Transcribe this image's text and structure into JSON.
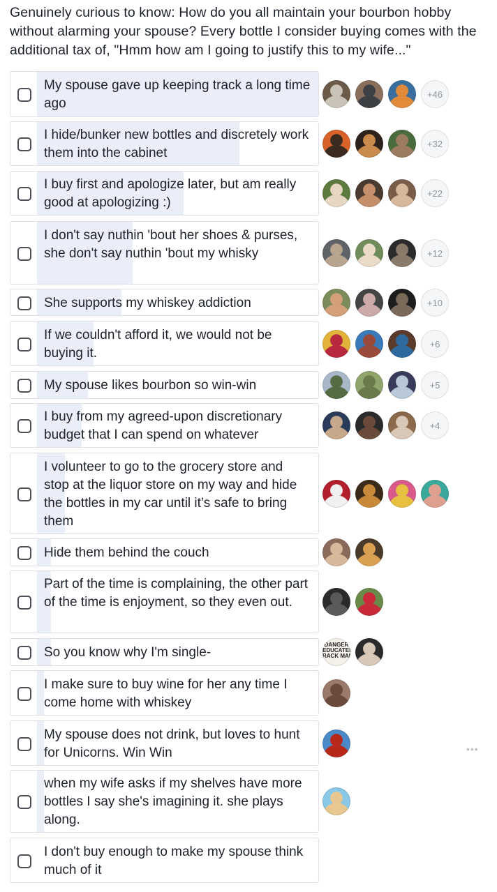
{
  "question": "Genuinely curious to know: How do you all maintain your bourbon hobby without alarming your spouse? Every bottle I consider buying comes with the additional tax of, \"Hmm how am I going to justify this to my wife...\"",
  "options": [
    {
      "label": "My spouse gave up keeping track a long time ago",
      "share": 1.0,
      "more": "+46"
    },
    {
      "label": "I hide/bunker new bottles and discretely work them into the cabinet",
      "share": 0.72,
      "more": "+32"
    },
    {
      "label": "I buy first and apologize later, but am really good at apologizing :)",
      "share": 0.52,
      "more": "+22"
    },
    {
      "label": "I don't say nuthin 'bout her shoes & purses, she don't say nuthin 'bout my whisky",
      "share": 0.34,
      "more": "+12"
    },
    {
      "label": "She supports my whiskey addiction",
      "share": 0.3,
      "more": "+10"
    },
    {
      "label": "If we couldn't afford it, we would not be buying it.",
      "share": 0.2,
      "more": "+6"
    },
    {
      "label": "My spouse likes bourbon so win-win",
      "share": 0.18,
      "more": "+5"
    },
    {
      "label": "I buy from my agreed-upon discretionary budget that I can spend on whatever",
      "share": 0.16,
      "more": "+4"
    },
    {
      "label": "I volunteer to go to the grocery store and stop at the liquor store on my way and hide the bottles in my car until it’s safe to bring them",
      "share": 0.1,
      "more": ""
    },
    {
      "label": "Hide them behind the couch",
      "share": 0.05,
      "more": ""
    },
    {
      "label": "Part of the time is complaining, the other part of the time is enjoyment, so they even out.",
      "share": 0.05,
      "more": ""
    },
    {
      "label": "So you know why I'm single-",
      "share": 0.05,
      "more": ""
    },
    {
      "label": "I make sure to buy wine for her any time I come home with whiskey",
      "share": 0.025,
      "more": ""
    },
    {
      "label": "My spouse does not drink, but loves to hunt for Unicorns. Win Win",
      "share": 0.025,
      "more": ""
    },
    {
      "label": "when my wife asks if my shelves have more bottles I say she's imagining it. she plays along.",
      "share": 0.025,
      "more": ""
    },
    {
      "label": "I don't buy enough to make my spouse think much of it",
      "share": 0.0,
      "more": ""
    }
  ],
  "sign_text": "DANGER\nEDUCATED\nRACK MAN",
  "more_options_icon": "ellipsis-icon",
  "colors": {
    "vote_fill": "#e9eef8",
    "border": "#dddfe2",
    "text": "#1d2129",
    "muted": "#90949c"
  }
}
